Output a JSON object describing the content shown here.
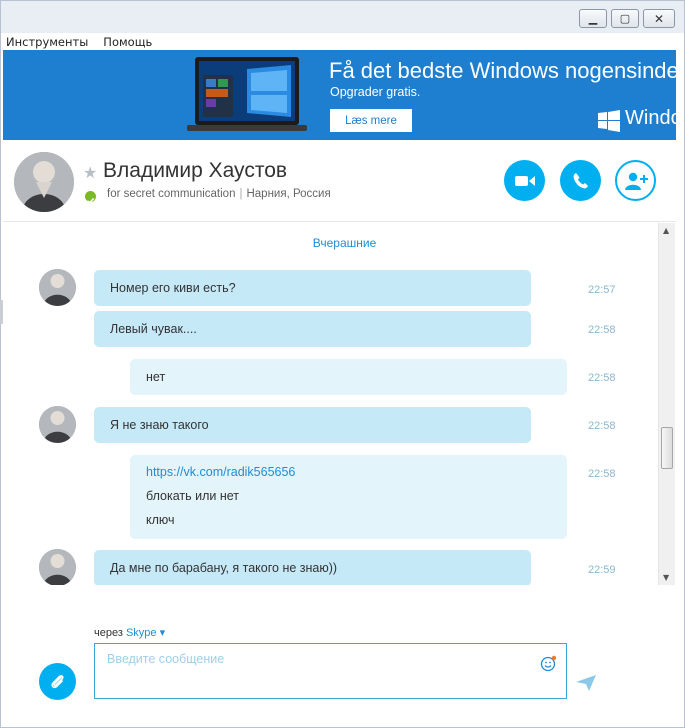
{
  "window": {
    "controls": {
      "minimize": "▁",
      "maximize": "▢",
      "close": "✕"
    }
  },
  "menu": {
    "items": [
      "Инструменты",
      "Помощь"
    ]
  },
  "ad": {
    "title": "Få det bedste Windows nogensinde.",
    "subtitle": "Opgrader gratis.",
    "button": "Læs mere",
    "brand": "Windo"
  },
  "contact": {
    "name": "Владимир Хаустов",
    "mood": "for secret communication",
    "location": "Нарния, Россия",
    "status_color": "#7ab929"
  },
  "header_buttons": {
    "video": "video-call-icon",
    "call": "phone-icon",
    "add": "add-contact-icon"
  },
  "chat": {
    "date_separator": "Вчерашние",
    "messages": [
      {
        "direction": "in",
        "avatar": true,
        "lines": [
          "Номер его киви есть?"
        ],
        "time": "22:57"
      },
      {
        "direction": "in",
        "avatar": false,
        "lines": [
          "Левый чувак...."
        ],
        "time": "22:58"
      },
      {
        "direction": "out",
        "lines": [
          "нет"
        ],
        "time": "22:58"
      },
      {
        "direction": "in",
        "avatar": true,
        "lines": [
          "Я не знаю такого"
        ],
        "time": "22:58"
      },
      {
        "direction": "out",
        "lines": [
          "https://vk.com/radik565656",
          "блокать или нет",
          "ключ"
        ],
        "time": "22:58"
      },
      {
        "direction": "in",
        "avatar": true,
        "lines": [
          "Да мне по барабану, я такого не знаю))"
        ],
        "time": "22:59"
      }
    ]
  },
  "compose": {
    "via_label": "через",
    "via_service": "Skype",
    "placeholder": "Введите сообщение"
  },
  "colors": {
    "accent": "#00aff0",
    "ad_background": "#1e7fd0",
    "incoming_bubble": "#c6e9f8",
    "outgoing_bubble": "#e3f4fb",
    "link": "#1f8dd6"
  }
}
